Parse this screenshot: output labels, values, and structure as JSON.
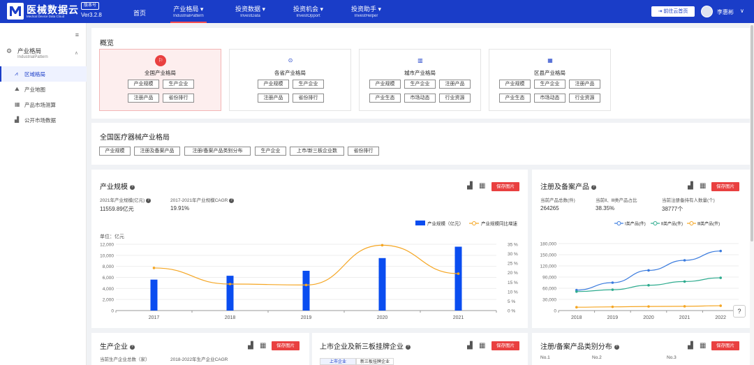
{
  "header": {
    "brand": "医械数据云",
    "brand_sub": "Medical Device Data Cloud",
    "version_badge": "版本号",
    "version": "Ver3.2.8",
    "nav": [
      {
        "cn": "首页",
        "en": ""
      },
      {
        "cn": "产业格局 ▾",
        "en": "IndustrialPattern"
      },
      {
        "cn": "投资数据 ▾",
        "en": "InvestData"
      },
      {
        "cn": "投资机会 ▾",
        "en": "InvestOpport"
      },
      {
        "cn": "投资助手 ▾",
        "en": "InvestHelper"
      }
    ],
    "cloud_button": "前往云首页",
    "user": "李惠彬",
    "accent": "#1a3dc8"
  },
  "sidebar": {
    "group_cn": "产业格局",
    "group_en": "IndustrialPattern",
    "items": [
      {
        "label": "区域格局",
        "icon": "chart-icon",
        "active": true
      },
      {
        "label": "产业地图",
        "icon": "map-icon",
        "active": false
      },
      {
        "label": "产品市场测算",
        "icon": "calculator-icon",
        "active": false
      },
      {
        "label": "公开市场数据",
        "icon": "bar-chart-icon",
        "active": false
      }
    ]
  },
  "overview": {
    "title": "概览",
    "cards": [
      {
        "title": "全国产业格局",
        "tags": [
          "产业规模",
          "生产企业",
          "注册产品",
          "省份排行"
        ]
      },
      {
        "title": "各省产业格局",
        "tags": [
          "产业规模",
          "生产企业",
          "注册产品",
          "省份排行"
        ]
      },
      {
        "title": "城市产业格局",
        "tags": [
          "产业规模",
          "生产企业",
          "注册产品",
          "产业生态",
          "市场动态",
          "行业资源"
        ]
      },
      {
        "title": "区县产业格局",
        "tags": [
          "产业规模",
          "生产企业",
          "注册产品",
          "产业生态",
          "市场动态",
          "行业资源"
        ]
      }
    ]
  },
  "national": {
    "title": "全国医疗器械产业格局",
    "tags": [
      "产业规模",
      "注册及备案产品",
      "注册/备案产品类别分布",
      "生产企业",
      "上市/新三板企业数",
      "省份排行"
    ]
  },
  "scale_panel": {
    "title": "产业规模",
    "save": "保存图片",
    "stat1_label": "2021年产业规模(亿元)",
    "stat1_value": "11559.89亿元",
    "stat2_label": "2017-2021年产业规模CAGR",
    "stat2_value": "19.91%",
    "unit": "单位：亿元"
  },
  "reg_panel": {
    "title": "注册及备案产品",
    "save": "保存图片",
    "s1_label": "当前产品总数(件)",
    "s1_value": "264265",
    "s2_label": "当前Ⅱ、Ⅲ类产品占比",
    "s2_value": "38.35%",
    "s3_label": "当前注册备持有人数量(个)",
    "s3_value": "38777个"
  },
  "bottom": {
    "p1_title": "生产企业",
    "p1_s1": "当前生产企业总数（家）",
    "p1_s2": "2018-2022年生产企业CAGR",
    "p2_title": "上市企业及新三板挂牌企业",
    "p2_tab1": "上市企业",
    "p2_tab2": "新三板挂牌企业",
    "p3_title": "注册/备案产品类别分布",
    "p3_cols": [
      "No.1",
      "No.2",
      "No.3"
    ],
    "save": "保存图片"
  },
  "chart_data": [
    {
      "type": "bar",
      "categories": [
        "2017",
        "2018",
        "2019",
        "2020",
        "2021"
      ],
      "series": [
        {
          "name": "产业规模（亿元）",
          "type": "bar",
          "values": [
            5600,
            6300,
            7200,
            9500,
            11559.89
          ],
          "axis": "left",
          "color": "#0a4df0"
        },
        {
          "name": "产业规模同比增速",
          "type": "line",
          "values": [
            22.5,
            14.0,
            13.5,
            34.5,
            19.5
          ],
          "axis": "right",
          "color": "#f5a623"
        }
      ],
      "ylabel": "单位：亿元",
      "ylim": [
        0,
        12000
      ],
      "yticks": [
        "0",
        "2,000",
        "4,000",
        "6,000",
        "8,000",
        "10,000",
        "12,000"
      ],
      "y2lim": [
        0,
        35
      ],
      "y2ticks": [
        "0 %",
        "5 %",
        "10 %",
        "15 %",
        "20 %",
        "25 %",
        "30 %",
        "35 %"
      ],
      "legend": "top-right"
    },
    {
      "type": "line",
      "categories": [
        "2018",
        "2019",
        "2020",
        "2021",
        "2022"
      ],
      "series": [
        {
          "name": "Ⅰ类产品(件)",
          "values": [
            55000,
            75000,
            108000,
            135000,
            160000
          ],
          "color": "#3a7bde"
        },
        {
          "name": "Ⅱ类产品(件)",
          "values": [
            51000,
            56000,
            68000,
            78000,
            88000
          ],
          "color": "#2dab8e"
        },
        {
          "name": "Ⅲ类产品(件)",
          "values": [
            9000,
            10000,
            11000,
            11500,
            13000
          ],
          "color": "#f5a623"
        }
      ],
      "ylim": [
        0,
        180000
      ],
      "yticks": [
        "0",
        "30,000",
        "60,000",
        "90,000",
        "120,000",
        "150,000",
        "180,000"
      ],
      "legend": "top-right"
    }
  ]
}
